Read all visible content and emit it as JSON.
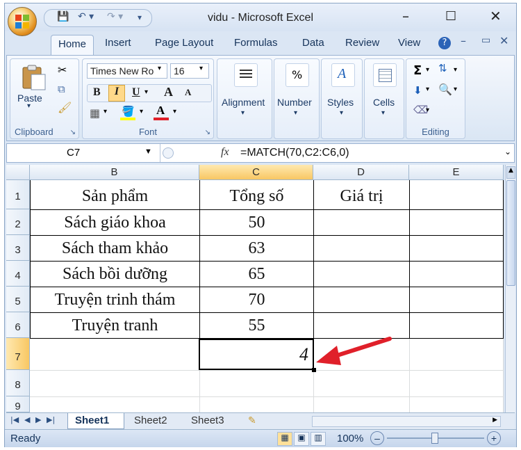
{
  "window": {
    "title": "vidu - Microsoft Excel",
    "minimize": "–",
    "maximize": "☐",
    "close": "✕"
  },
  "qat": {
    "save": "💾",
    "undo": "↶ ▾",
    "redo": "↷ ▾",
    "customize": "₹"
  },
  "tabs": [
    "Home",
    "Insert",
    "Page Layout",
    "Formulas",
    "Data",
    "Review",
    "View"
  ],
  "ribbon": {
    "clipboard": {
      "paste": "Paste",
      "label": "Clipboard"
    },
    "font": {
      "name": "Times New Ro",
      "size": "16",
      "bold": "B",
      "italic": "I",
      "underline": "U",
      "grow": "A",
      "shrink": "A",
      "label": "Font"
    },
    "alignment": {
      "label": "Alignment"
    },
    "number": {
      "label": "Number",
      "symbol": "%"
    },
    "styles": {
      "label": "Styles"
    },
    "cells": {
      "label": "Cells"
    },
    "editing": {
      "label": "Editing",
      "sum": "Σ"
    }
  },
  "formula_bar": {
    "name_box": "C7",
    "fx": "fx",
    "formula": "=MATCH(70,C2:C6,0)"
  },
  "columns": [
    "B",
    "C",
    "D",
    "E"
  ],
  "rows": [
    "1",
    "2",
    "3",
    "4",
    "5",
    "6",
    "7",
    "8",
    "9"
  ],
  "cells": {
    "header": {
      "b": "Sản phẩm",
      "c": "Tổng số",
      "d": "Giá trị"
    },
    "data": [
      {
        "b": "Sách giáo khoa",
        "c": "50"
      },
      {
        "b": "Sách tham khảo",
        "c": "63"
      },
      {
        "b": "Sách bồi dưỡng",
        "c": "65"
      },
      {
        "b": "Truyện trinh thám",
        "c": "70"
      },
      {
        "b": "Truyện tranh",
        "c": "55"
      }
    ],
    "result": "4"
  },
  "sheets": [
    "Sheet1",
    "Sheet2",
    "Sheet3"
  ],
  "status": {
    "text": "Ready",
    "zoom": "100%"
  },
  "colors": {
    "arrow": "#e0202a",
    "selected_header": "#f8c763"
  }
}
